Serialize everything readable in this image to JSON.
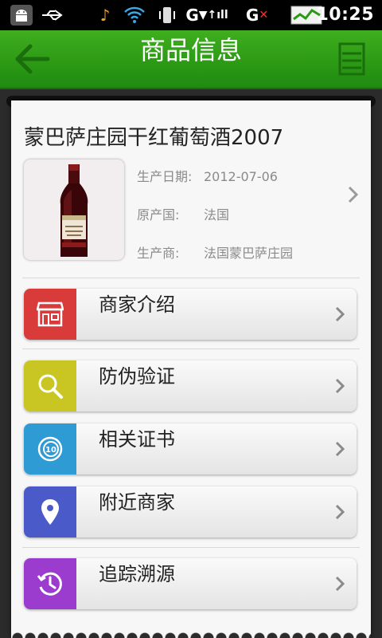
{
  "status_bar": {
    "time": "10:25"
  },
  "header": {
    "title": "商品信息"
  },
  "product": {
    "name": "蒙巴萨庄园干红葡萄酒2007",
    "image_label": "Chateau",
    "info": [
      {
        "key": "生产日期:",
        "value": "2012-07-06"
      },
      {
        "key": "原产国:",
        "value": "法国"
      },
      {
        "key": "生产商:",
        "value": "法国蒙巴萨庄园"
      }
    ]
  },
  "menu": [
    {
      "label": "商家介绍",
      "icon": "store-icon",
      "color": "#d93a3a"
    },
    {
      "label": "防伪验证",
      "icon": "search-icon",
      "color": "#c9c624"
    },
    {
      "label": "相关证书",
      "icon": "certificate-icon",
      "color": "#2f9bd4"
    },
    {
      "label": "附近商家",
      "icon": "location-pin-icon",
      "color": "#4a5bc9"
    },
    {
      "label": "追踪溯源",
      "icon": "history-icon",
      "color": "#9b3ccf"
    }
  ],
  "colors": {
    "brand_green": "#2a9a15"
  }
}
